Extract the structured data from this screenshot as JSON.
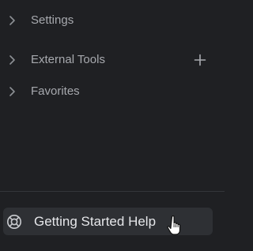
{
  "sidebar": {
    "items": [
      {
        "label": "Settings",
        "icon": "chevron-right-icon"
      },
      {
        "label": "External Tools",
        "icon": "chevron-right-icon",
        "action_icon": "plus-icon"
      },
      {
        "label": "Favorites",
        "icon": "chevron-right-icon"
      }
    ]
  },
  "footer": {
    "help_label": "Getting Started Help",
    "help_icon": "lifebuoy-icon"
  },
  "colors": {
    "background": "#1f2023",
    "button_background": "#2e3034",
    "label": "#a7a9ae",
    "button_text": "#e6e7ea"
  }
}
